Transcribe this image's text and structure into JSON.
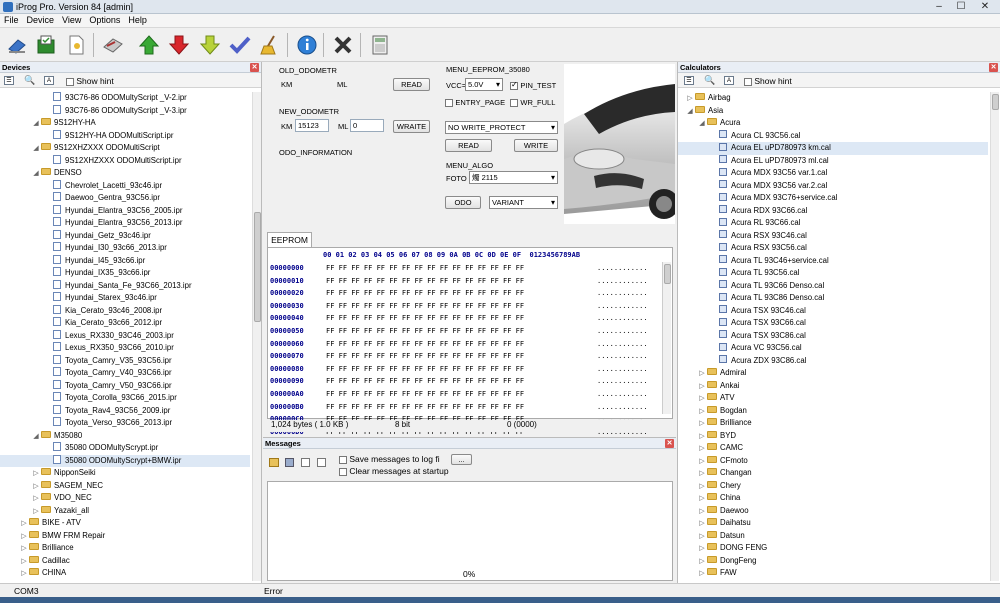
{
  "window": {
    "title": "iProg Pro. Version 84 [admin]",
    "minimize": "–",
    "maximize": "☐",
    "close": "✕"
  },
  "menu": [
    "File",
    "Device",
    "View",
    "Options",
    "Help"
  ],
  "toolbar": {
    "icons": [
      "eraser-icon",
      "chip-save-icon",
      "new-file-icon",
      "tools-icon",
      "arrow-up-icon",
      "arrow-down-icon",
      "arrow-down-yellow-icon",
      "check-icon",
      "broom-icon",
      "info-icon",
      "close-x-icon",
      "calculator-icon"
    ]
  },
  "devices": {
    "title": "Devices",
    "show_hint": "Show hint",
    "items": [
      {
        "level": 2,
        "kind": "file",
        "label": "93C76-86  ODOMultyScript _V-2.ipr"
      },
      {
        "level": 2,
        "kind": "file",
        "label": "93C76-86  ODOMultyScript _V-3.ipr"
      },
      {
        "level": 1,
        "kind": "folder",
        "expanded": true,
        "label": "9S12HY-HA"
      },
      {
        "level": 2,
        "kind": "file",
        "label": "9S12HY-HA  ODOMultiScript.ipr"
      },
      {
        "level": 1,
        "kind": "folder",
        "expanded": true,
        "label": "9S12XHZXXX  ODOMultiScript"
      },
      {
        "level": 2,
        "kind": "file",
        "label": "9S12XHZXXX  ODOMultiScript.ipr"
      },
      {
        "level": 1,
        "kind": "folder",
        "expanded": true,
        "label": "DENSO"
      },
      {
        "level": 2,
        "kind": "file",
        "label": "Chevrolet_Lacetti_93c46.ipr"
      },
      {
        "level": 2,
        "kind": "file",
        "label": "Daewoo_Gentra_93C56.ipr"
      },
      {
        "level": 2,
        "kind": "file",
        "label": "Hyundai_Elantra_93C56_2005.ipr"
      },
      {
        "level": 2,
        "kind": "file",
        "label": "Hyundai_Elantra_93C56_2013.ipr"
      },
      {
        "level": 2,
        "kind": "file",
        "label": "Hyundai_Getz_93c46.ipr"
      },
      {
        "level": 2,
        "kind": "file",
        "label": "Hyundai_I30_93c66_2013.ipr"
      },
      {
        "level": 2,
        "kind": "file",
        "label": "Hyundai_I45_93c66.ipr"
      },
      {
        "level": 2,
        "kind": "file",
        "label": "Hyundai_IX35_93c66.ipr"
      },
      {
        "level": 2,
        "kind": "file",
        "label": "Hyundai_Santa_Fe_93C66_2013.ipr"
      },
      {
        "level": 2,
        "kind": "file",
        "label": "Hyundai_Starex_93c46.ipr"
      },
      {
        "level": 2,
        "kind": "file",
        "label": "Kia_Cerato_93c46_2008.ipr"
      },
      {
        "level": 2,
        "kind": "file",
        "label": "Kia_Cerato_93c66_2012.ipr"
      },
      {
        "level": 2,
        "kind": "file",
        "label": "Lexus_RX330_93C46_2003.ipr"
      },
      {
        "level": 2,
        "kind": "file",
        "label": "Lexus_RX350_93C66_2010.ipr"
      },
      {
        "level": 2,
        "kind": "file",
        "label": "Toyota_Camry_V35_93C56.ipr"
      },
      {
        "level": 2,
        "kind": "file",
        "label": "Toyota_Camry_V40_93C66.ipr"
      },
      {
        "level": 2,
        "kind": "file",
        "label": "Toyota_Camry_V50_93C66.ipr"
      },
      {
        "level": 2,
        "kind": "file",
        "label": "Toyota_Corolla_93C66_2015.ipr"
      },
      {
        "level": 2,
        "kind": "file",
        "label": "Toyota_Rav4_93C56_2009.ipr"
      },
      {
        "level": 2,
        "kind": "file",
        "label": "Toyota_Verso_93C66_2013.ipr"
      },
      {
        "level": 1,
        "kind": "folder",
        "expanded": true,
        "label": "M35080"
      },
      {
        "level": 2,
        "kind": "file",
        "label": "35080  ODOMultyScrypt.ipr"
      },
      {
        "level": 2,
        "kind": "file",
        "label": "35080  ODOMultyScrypt+BMW.ipr",
        "selected": true
      },
      {
        "level": 1,
        "kind": "folder",
        "expanded": false,
        "label": "NipponSeiki"
      },
      {
        "level": 1,
        "kind": "folder",
        "expanded": false,
        "label": "SAGEM_NEC"
      },
      {
        "level": 1,
        "kind": "folder",
        "expanded": false,
        "label": "VDO_NEC"
      },
      {
        "level": 1,
        "kind": "folder",
        "expanded": false,
        "label": "Yazaki_all"
      },
      {
        "level": 0,
        "kind": "folder",
        "expanded": false,
        "label": "BIKE - ATV"
      },
      {
        "level": 0,
        "kind": "folder",
        "expanded": false,
        "label": "BMW FRM Repair"
      },
      {
        "level": 0,
        "kind": "folder",
        "expanded": false,
        "label": "Brilliance"
      },
      {
        "level": 0,
        "kind": "folder",
        "expanded": false,
        "label": "Cadillac"
      },
      {
        "level": 0,
        "kind": "folder",
        "expanded": false,
        "label": "CHINA"
      }
    ]
  },
  "odometer": {
    "old_title": "OLD_ODOMETR",
    "km": "KM",
    "ml": "ML",
    "read": "READ",
    "new_title": "NEW_ODOMETR",
    "km_value": "15123",
    "ml_value": "0",
    "write": "WRAITE",
    "info_title": "ODO_INFORMATION"
  },
  "eeprom_menu": {
    "title": "MENU_EEPROM_35080",
    "vcc_label": "VCC=",
    "vcc_value": "5.0V",
    "pin_test": "PIN_TEST",
    "entry_page": "ENTRY_PAGE",
    "wr_full": "WR_FULL",
    "protect": "NO WRITE_PROTECT",
    "read": "READ",
    "write": "WRITE"
  },
  "algo_menu": {
    "title": "MENU_ALGO",
    "foto_label": "FOTO",
    "foto_value": "燭 2115",
    "odo": "ODO",
    "variant": "VARIANT"
  },
  "eeprom": {
    "tab": "EEPROM",
    "header": "00 01 02 03 04 05 06 07 08 09 0A 0B 0C 0D 0E 0F  0123456789AB",
    "rows": [
      {
        "addr": "00000000",
        "data": "FF FF FF FF FF FF FF FF FF FF FF FF FF FF FF FF",
        "ascii": "............"
      },
      {
        "addr": "00000010",
        "data": "FF FF FF FF FF FF FF FF FF FF FF FF FF FF FF FF",
        "ascii": "............"
      },
      {
        "addr": "00000020",
        "data": "FF FF FF FF FF FF FF FF FF FF FF FF FF FF FF FF",
        "ascii": "............"
      },
      {
        "addr": "00000030",
        "data": "FF FF FF FF FF FF FF FF FF FF FF FF FF FF FF FF",
        "ascii": "............"
      },
      {
        "addr": "00000040",
        "data": "FF FF FF FF FF FF FF FF FF FF FF FF FF FF FF FF",
        "ascii": "............"
      },
      {
        "addr": "00000050",
        "data": "FF FF FF FF FF FF FF FF FF FF FF FF FF FF FF FF",
        "ascii": "............"
      },
      {
        "addr": "00000060",
        "data": "FF FF FF FF FF FF FF FF FF FF FF FF FF FF FF FF",
        "ascii": "............"
      },
      {
        "addr": "00000070",
        "data": "FF FF FF FF FF FF FF FF FF FF FF FF FF FF FF FF",
        "ascii": "............"
      },
      {
        "addr": "00000080",
        "data": "FF FF FF FF FF FF FF FF FF FF FF FF FF FF FF FF",
        "ascii": "............"
      },
      {
        "addr": "00000090",
        "data": "FF FF FF FF FF FF FF FF FF FF FF FF FF FF FF FF",
        "ascii": "............"
      },
      {
        "addr": "000000A0",
        "data": "FF FF FF FF FF FF FF FF FF FF FF FF FF FF FF FF",
        "ascii": "............"
      },
      {
        "addr": "000000B0",
        "data": "FF FF FF FF FF FF FF FF FF FF FF FF FF FF FF FF",
        "ascii": "............"
      },
      {
        "addr": "000000C0",
        "data": "FF FF FF FF FF FF FF FF FF FF FF FF FF FF FF FF",
        "ascii": "............"
      },
      {
        "addr": "000000D0",
        "data": "FF FF FF FF FF FF FF FF FF FF FF FF FF FF FF FF",
        "ascii": "............"
      }
    ],
    "size": "1,024 bytes ( 1.0 KB )",
    "bits": "8 bit",
    "position": "0 (0000)"
  },
  "messages": {
    "title": "Messages",
    "save_log": "Save messages to log fi",
    "browse": "...",
    "clear_startup": "Clear messages at startup",
    "progress": "0%"
  },
  "calculators": {
    "title": "Calculators",
    "show_hint": "Show hint",
    "items": [
      {
        "level": 0,
        "kind": "folder",
        "expanded": false,
        "label": "Airbag"
      },
      {
        "level": 0,
        "kind": "folder",
        "expanded": true,
        "label": "Asia"
      },
      {
        "level": 1,
        "kind": "folder",
        "expanded": true,
        "label": "Acura"
      },
      {
        "level": 2,
        "kind": "file",
        "label": "Acura CL 93C56.cal"
      },
      {
        "level": 2,
        "kind": "file",
        "label": "Acura EL uPD780973 km.cal",
        "selected": true
      },
      {
        "level": 2,
        "kind": "file",
        "label": "Acura EL uPD780973 ml.cal"
      },
      {
        "level": 2,
        "kind": "file",
        "label": "Acura MDX 93C56 var.1.cal"
      },
      {
        "level": 2,
        "kind": "file",
        "label": "Acura MDX 93C56 var.2.cal"
      },
      {
        "level": 2,
        "kind": "file",
        "label": "Acura MDX 93C76+service.cal"
      },
      {
        "level": 2,
        "kind": "file",
        "label": "Acura RDX 93C66.cal"
      },
      {
        "level": 2,
        "kind": "file",
        "label": "Acura RL 93C66.cal"
      },
      {
        "level": 2,
        "kind": "file",
        "label": "Acura RSX 93C46.cal"
      },
      {
        "level": 2,
        "kind": "file",
        "label": "Acura RSX 93C56.cal"
      },
      {
        "level": 2,
        "kind": "file",
        "label": "Acura TL 93C46+service.cal"
      },
      {
        "level": 2,
        "kind": "file",
        "label": "Acura TL 93C56.cal"
      },
      {
        "level": 2,
        "kind": "file",
        "label": "Acura TL 93C66 Denso.cal"
      },
      {
        "level": 2,
        "kind": "file",
        "label": "Acura TL 93C86 Denso.cal"
      },
      {
        "level": 2,
        "kind": "file",
        "label": "Acura TSX 93C46.cal"
      },
      {
        "level": 2,
        "kind": "file",
        "label": "Acura TSX 93C66.cal"
      },
      {
        "level": 2,
        "kind": "file",
        "label": "Acura TSX 93C86.cal"
      },
      {
        "level": 2,
        "kind": "file",
        "label": "Acura VC 93C56.cal"
      },
      {
        "level": 2,
        "kind": "file",
        "label": "Acura ZDX 93C86.cal"
      },
      {
        "level": 1,
        "kind": "folder",
        "expanded": false,
        "label": "Admiral"
      },
      {
        "level": 1,
        "kind": "folder",
        "expanded": false,
        "label": "Ankai"
      },
      {
        "level": 1,
        "kind": "folder",
        "expanded": false,
        "label": "ATV"
      },
      {
        "level": 1,
        "kind": "folder",
        "expanded": false,
        "label": "Bogdan"
      },
      {
        "level": 1,
        "kind": "folder",
        "expanded": false,
        "label": "Brilliance"
      },
      {
        "level": 1,
        "kind": "folder",
        "expanded": false,
        "label": "BYD"
      },
      {
        "level": 1,
        "kind": "folder",
        "expanded": false,
        "label": "CAMC"
      },
      {
        "level": 1,
        "kind": "folder",
        "expanded": false,
        "label": "CFmoto"
      },
      {
        "level": 1,
        "kind": "folder",
        "expanded": false,
        "label": "Changan"
      },
      {
        "level": 1,
        "kind": "folder",
        "expanded": false,
        "label": "Chery"
      },
      {
        "level": 1,
        "kind": "folder",
        "expanded": false,
        "label": "China"
      },
      {
        "level": 1,
        "kind": "folder",
        "expanded": false,
        "label": "Daewoo"
      },
      {
        "level": 1,
        "kind": "folder",
        "expanded": false,
        "label": "Daihatsu"
      },
      {
        "level": 1,
        "kind": "folder",
        "expanded": false,
        "label": "Datsun"
      },
      {
        "level": 1,
        "kind": "folder",
        "expanded": false,
        "label": "DONG FENG"
      },
      {
        "level": 1,
        "kind": "folder",
        "expanded": false,
        "label": "DongFeng"
      },
      {
        "level": 1,
        "kind": "folder",
        "expanded": false,
        "label": "FAW"
      }
    ]
  },
  "status": {
    "port": "COM3",
    "state": "Error"
  }
}
